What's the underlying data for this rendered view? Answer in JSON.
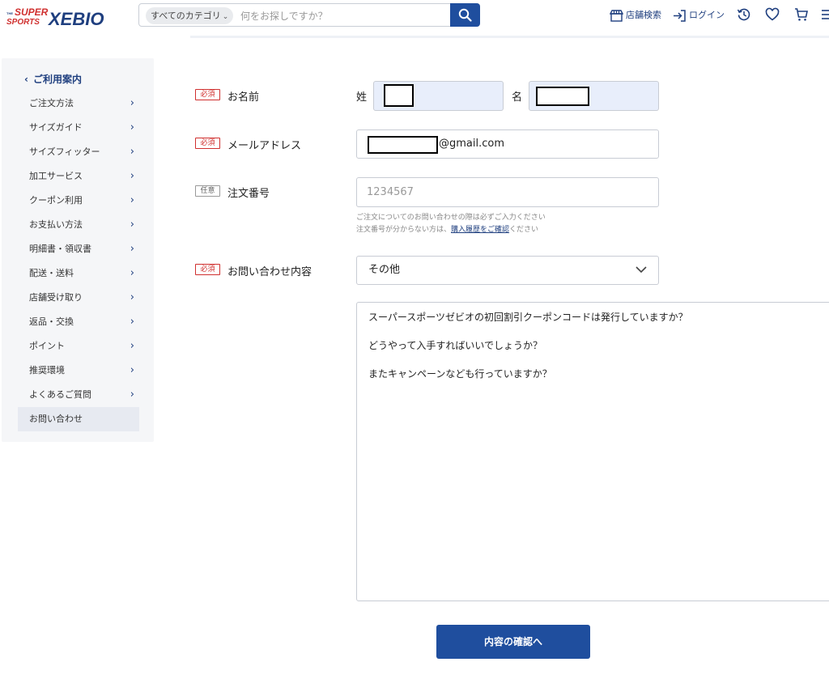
{
  "header": {
    "logo_top": "SUPER",
    "logo_sports": "SPORTS",
    "logo_main": "XEBIO",
    "category_label": "すべてのカテゴリ",
    "search_placeholder": "何をお探しですか？",
    "store_search_label": "店舗検索",
    "login_label": "ログイン",
    "brand_color": "#1f4e9e",
    "logo_color": "#d0302f"
  },
  "sidebar": {
    "title": "ご利用案内",
    "items": [
      {
        "label": "ご注文方法"
      },
      {
        "label": "サイズガイド"
      },
      {
        "label": "サイズフィッター"
      },
      {
        "label": "加工サービス"
      },
      {
        "label": "クーポン利用"
      },
      {
        "label": "お支払い方法"
      },
      {
        "label": "明細書・領収書"
      },
      {
        "label": "配送・送料"
      },
      {
        "label": "店舗受け取り"
      },
      {
        "label": "返品・交換"
      },
      {
        "label": "ポイント"
      },
      {
        "label": "推奨環境"
      },
      {
        "label": "よくあるご質問"
      },
      {
        "label": "お問い合わせ",
        "active": true
      }
    ]
  },
  "form": {
    "required_badge": "必須",
    "optional_badge": "任意",
    "name": {
      "label": "お名前",
      "last_label": "姓",
      "first_label": "名"
    },
    "email": {
      "label": "メールアドレス",
      "value_suffix": "@gmail.com"
    },
    "order_number": {
      "label": "注文番号",
      "placeholder": "1234567",
      "help_line1": "ご注文についてのお問い合わせの際は必ずご入力ください",
      "help_line2_prefix": "注文番号が分からない方は、",
      "help_link": "購入履歴をご確認",
      "help_line2_suffix": "ください"
    },
    "inquiry": {
      "label": "お問い合わせ内容",
      "selected": "その他",
      "message_lines": [
        "スーパースポーツゼビオの初回割引クーポンコードは発行していますか？",
        "どうやって入手すればいいでしょうか？",
        "またキャンペーンなども行っていますか？"
      ]
    },
    "submit_label": "内容の確認へ"
  }
}
